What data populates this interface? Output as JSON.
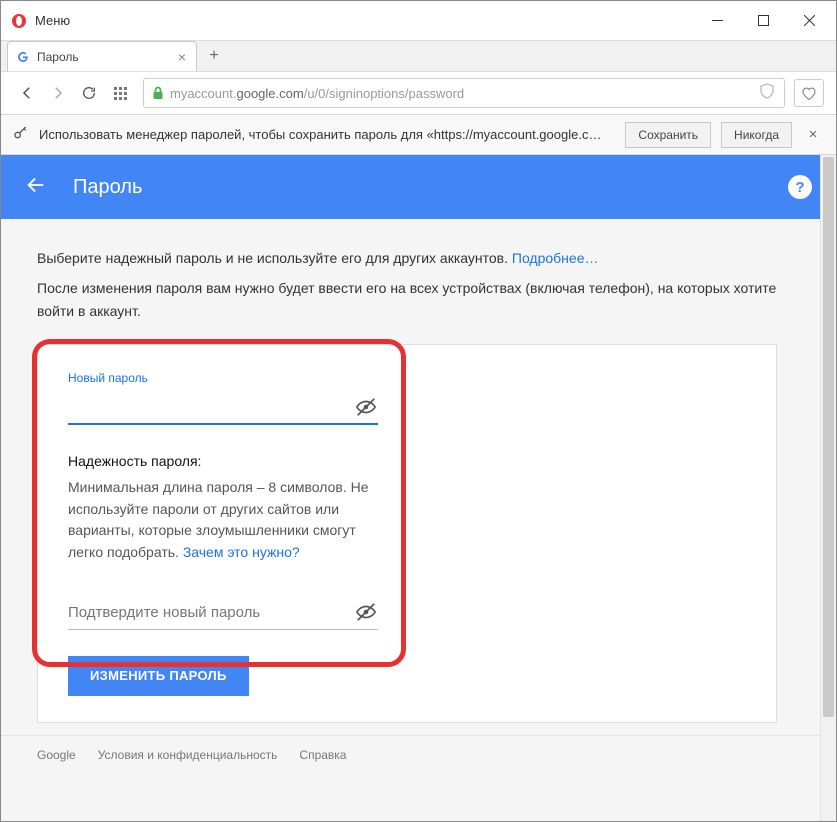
{
  "titlebar": {
    "menu_label": "Меню"
  },
  "tab": {
    "title": "Пароль"
  },
  "url": {
    "prefix": "myaccount.",
    "host": "google.com",
    "path": "/u/0/signinoptions/password"
  },
  "pwbar": {
    "message": "Использовать менеджер паролей, чтобы сохранить пароль для «https://myaccount.google.c…",
    "save": "Сохранить",
    "never": "Никогда"
  },
  "appbar": {
    "title": "Пароль"
  },
  "intro": {
    "line1": "Выберите надежный пароль и не используйте его для других аккаунтов.",
    "learn_more": "Подробнее…",
    "line2": "После изменения пароля вам нужно будет ввести его на всех устройствах (включая телефон), на которых хотите войти в аккаунт."
  },
  "form": {
    "new_password_label": "Новый пароль",
    "strength_title": "Надежность пароля:",
    "strength_body": "Минимальная длина пароля – 8 символов. Не используйте пароли от других сайтов или варианты, которые злоумышленники смогут легко подобрать.",
    "why_link": "Зачем это нужно?",
    "confirm_placeholder": "Подтвердите новый пароль",
    "submit": "ИЗМЕНИТЬ ПАРОЛЬ"
  },
  "footer": {
    "brand": "Google",
    "terms": "Условия и конфиденциальность",
    "help": "Справка"
  }
}
